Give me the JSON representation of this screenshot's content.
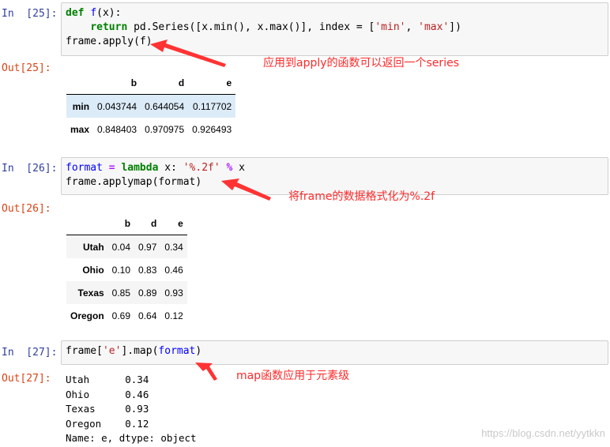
{
  "cells": [
    {
      "in_prompt": "In  [25]:",
      "out_prompt": "Out[25]:",
      "code_lines": [
        [
          {
            "t": "def",
            "c": "kw"
          },
          {
            "t": " "
          },
          {
            "t": "f",
            "c": "fn"
          },
          {
            "t": "(x):"
          }
        ],
        [
          {
            "t": "    "
          },
          {
            "t": "return",
            "c": "kw"
          },
          {
            "t": " pd.Series([x.min(), x.max()], index = ["
          },
          {
            "t": "'min'",
            "c": "str"
          },
          {
            "t": ", "
          },
          {
            "t": "'max'",
            "c": "str"
          },
          {
            "t": "])"
          }
        ],
        [
          {
            "t": "frame.apply(f)"
          }
        ]
      ],
      "table": {
        "columns": [
          "b",
          "d",
          "e"
        ],
        "rows": [
          {
            "index": "min",
            "values": [
              "0.043744",
              "0.644054",
              "0.117702"
            ]
          },
          {
            "index": "max",
            "values": [
              "0.848403",
              "0.970975",
              "0.926493"
            ]
          }
        ]
      },
      "annotation": "应用到apply的函数可以返回一个series"
    },
    {
      "in_prompt": "In  [26]:",
      "out_prompt": "Out[26]:",
      "code_lines": [
        [
          {
            "t": "format",
            "c": "fn"
          },
          {
            "t": " "
          },
          {
            "t": "=",
            "c": "op"
          },
          {
            "t": " "
          },
          {
            "t": "lambda",
            "c": "kw"
          },
          {
            "t": " x: "
          },
          {
            "t": "'%.2f'",
            "c": "str"
          },
          {
            "t": " "
          },
          {
            "t": "%",
            "c": "op"
          },
          {
            "t": " x"
          }
        ],
        [
          {
            "t": "frame.applymap(format)"
          }
        ]
      ],
      "table": {
        "columns": [
          "b",
          "d",
          "e"
        ],
        "rows": [
          {
            "index": "Utah",
            "values": [
              "0.04",
              "0.97",
              "0.34"
            ]
          },
          {
            "index": "Ohio",
            "values": [
              "0.10",
              "0.83",
              "0.46"
            ]
          },
          {
            "index": "Texas",
            "values": [
              "0.85",
              "0.89",
              "0.93"
            ]
          },
          {
            "index": "Oregon",
            "values": [
              "0.69",
              "0.64",
              "0.12"
            ]
          }
        ]
      },
      "annotation": "将frame的数据格式化为%.2f"
    },
    {
      "in_prompt": "In  [27]:",
      "out_prompt": "Out[27]:",
      "code_lines": [
        [
          {
            "t": "frame["
          },
          {
            "t": "'e'",
            "c": "str"
          },
          {
            "t": "].map("
          },
          {
            "t": "format",
            "c": "fn"
          },
          {
            "t": ")"
          }
        ]
      ],
      "stdout_lines": [
        "Utah      0.34",
        "Ohio      0.46",
        "Texas     0.93",
        "Oregon    0.12",
        "Name: e, dtype: object"
      ],
      "annotation": "map函数应用于元素级"
    }
  ],
  "watermark": "https://blog.csdn.net/yytkkn",
  "colors": {
    "in_prompt": "#303f9f",
    "out_prompt": "#d84315",
    "annotation": "#ff2a2a",
    "input_bg": "#f7f7f7"
  }
}
